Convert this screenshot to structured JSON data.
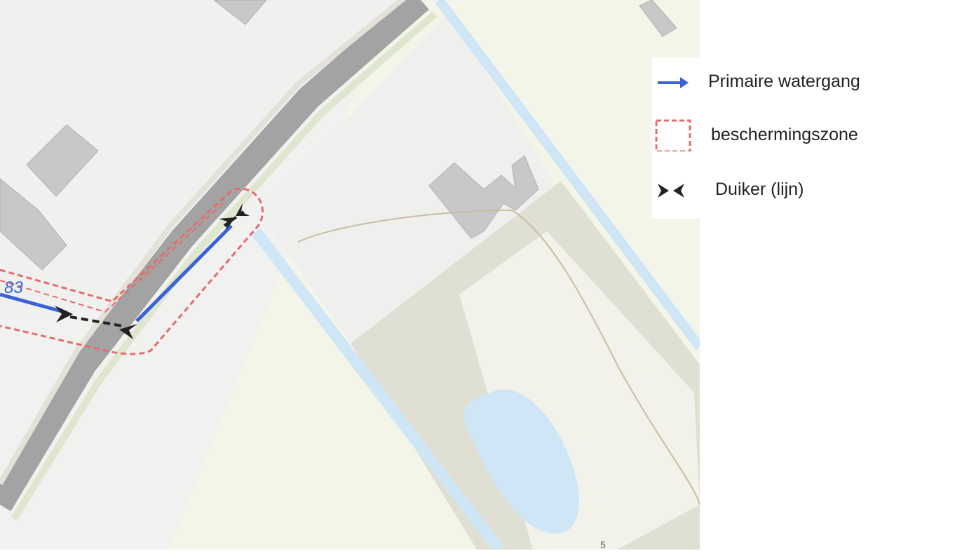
{
  "map": {
    "segment_label": "83",
    "colors": {
      "water": "#cfe6f7",
      "land": "#f0f0ee",
      "field": "#f4f5e9",
      "road": "#a3a3a3",
      "building": "#c8c8c8",
      "sand": "#e0dfd3",
      "watergang": "#3a63d6",
      "zone": "#e46c6c",
      "duiker": "#222222"
    }
  },
  "legend": {
    "items": [
      {
        "label": "Primaire watergang",
        "symbol": "blue-arrow-icon"
      },
      {
        "label": "beschermingszone",
        "symbol": "dashed-red-square-icon"
      },
      {
        "label": "Duiker (lijn)",
        "symbol": "duiker-chevrons-icon"
      }
    ]
  }
}
